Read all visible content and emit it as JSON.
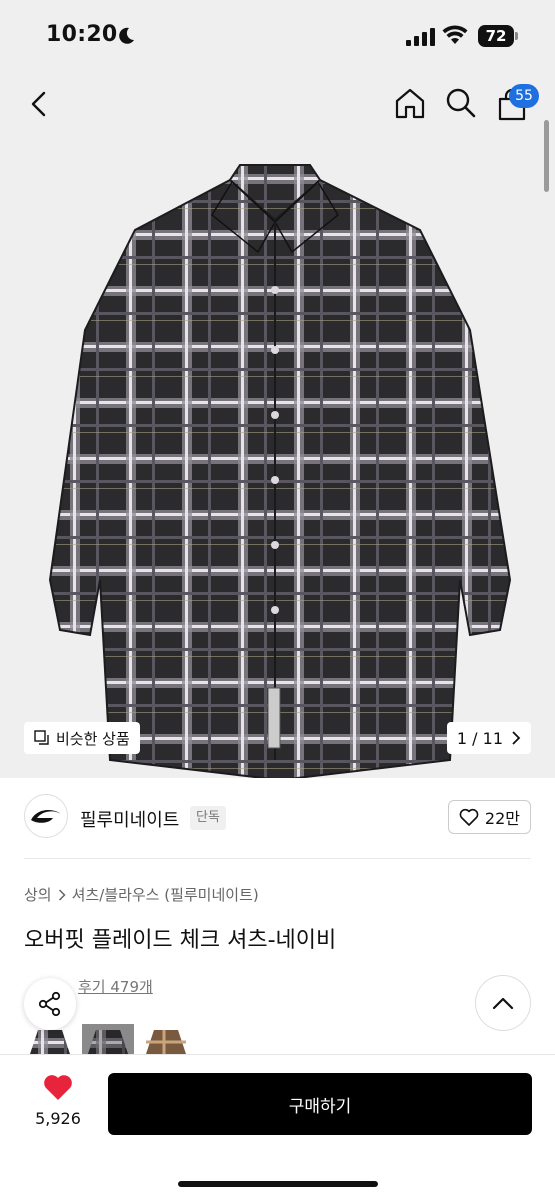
{
  "status_bar": {
    "time": "10:20",
    "battery": "72"
  },
  "header": {
    "cart_count": "55"
  },
  "gallery": {
    "similar_label": "비슷한 상품",
    "page_indicator": "1 / 11"
  },
  "brand": {
    "name": "필루미네이트",
    "tag": "단독",
    "likes": "22만"
  },
  "product": {
    "breadcrumb": [
      "상의",
      "셔츠/블라우스 (필루미네이트)"
    ],
    "title": "오버핏 플레이드 체크 셔츠-네이비",
    "review_label": "후기 479개"
  },
  "bottom_bar": {
    "wishlist_count": "5,926",
    "buy_label": "구매하기"
  },
  "colors": {
    "accent": "#1e6fe0",
    "heart": "#e8243c",
    "buy_bg": "#000000"
  },
  "icons": [
    "back-icon",
    "home-icon",
    "search-icon",
    "cart-icon",
    "moon-icon",
    "signal-icon",
    "wifi-icon",
    "battery-icon",
    "similar-icon",
    "chevron-right-icon",
    "heart-outline-icon",
    "share-icon",
    "chevron-up-icon",
    "heart-filled-icon"
  ]
}
